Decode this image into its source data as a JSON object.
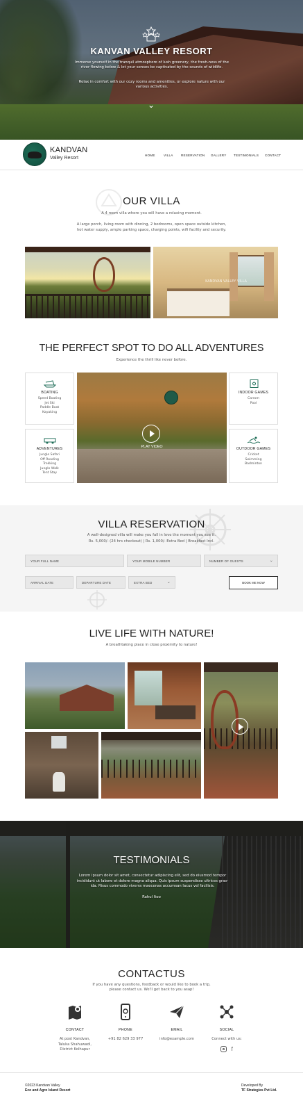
{
  "hero": {
    "title": "KANVAN VALLEY RESORT",
    "para1": "Immerse yourself in the tranquil atmosphere of lush greenery, the fresh-ness of the river flowing below & let your senses be captivated by the sounds of wildlife.",
    "para2": "Relax in comfort with our cozy rooms and amenities, or explore nature with our various activities."
  },
  "nav": {
    "brand": "KANDVAN",
    "brand_sub": "Valley Resort",
    "items": [
      "HOME",
      "VILLA",
      "RESERVATION",
      "GALLERY",
      "TESTIMONIALS",
      "CONTACT"
    ]
  },
  "villa": {
    "title": "OUR VILLA",
    "subtitle": "A 4 room villa where you will have a relaxing moment.",
    "desc": "A large porch, living room with dinning, 2 bedrooms, open space outside kitchen, hot water supply, ample parking space, charging points, wifi facility and security.",
    "watermark": "KANDVAN VALLEY VILLA"
  },
  "adventures": {
    "title": "THE PERFECT SPOT TO DO ALL ADVENTURES",
    "subtitle": "Experience the thrill like never before.",
    "play_label": "PLAY VIDEO",
    "cards": [
      {
        "title": "BOATING",
        "items": [
          "Speed Boating",
          "Jet Ski",
          "Paddle Boat",
          "Kayaking"
        ]
      },
      {
        "title": "ADVENTURES",
        "items": [
          "Jungle Safari",
          "Off Roading",
          "Trekking",
          "Jungle Walk",
          "Tent Stay"
        ]
      },
      {
        "title": "INDOOR GAMES",
        "items": [
          "Carrom",
          "Pool"
        ]
      },
      {
        "title": "OUTDOOR GAMES",
        "items": [
          "Cricket",
          "Swimming",
          "Badminton"
        ]
      }
    ]
  },
  "reservation": {
    "title": "VILLA RESERVATION",
    "subtitle": "A well-designed villa will make you fall in love the moment you see it.",
    "pricing": "Rs. 5,000/- (24 hrs checkout)  |  Rs. 1,000/- Extra Bed  |  Breakfast Incl.",
    "fields": {
      "name": "YOUR FULL NAME",
      "mobile": "YOUR MOBILE NUMBER",
      "guests": "NUMBER OF GUESTS",
      "arrival": "ARRIVAL DATE",
      "departure": "DEPARTURE DATE",
      "extra_bed": "EXTRA BED"
    },
    "button": "BOOK ME NOW"
  },
  "nature": {
    "title": "LIVE LIFE WITH NATURE!",
    "subtitle": "A breathtaking place in close proximity to nature!"
  },
  "testimonials": {
    "title": "TESTIMONIALS",
    "quote": "Lorem ipsum dolor sit amet, consectetur adipiscing elit, sed do eiusmod tempor incididunt ut labore et dolore magna aliqua. Quis ipsum suspendisse ultrices grav-ida. Risus commodo viverra maecenas accumsan lacus vel facilisis.",
    "author": "Rahul Itoo"
  },
  "contact": {
    "title": "CONTACTUS",
    "subtitle1": "If you have any questions, feedback or would like to book a trip,",
    "subtitle2": "please contact us. We'll get back to you asap!",
    "columns": [
      {
        "label": "CONTACT",
        "lines": [
          "At post Kandvan,",
          "Taluka Shahuwadi,",
          "District Kolhapur"
        ],
        "icon": "map-book-icon"
      },
      {
        "label": "PHONE",
        "lines": [
          "+91 82 629 33 977"
        ],
        "icon": "phone-icon"
      },
      {
        "label": "EMAIL",
        "lines": [
          "info@example.com"
        ],
        "icon": "paper-plane-icon"
      },
      {
        "label": "SOCIAL",
        "lines": [
          "Connect with us:"
        ],
        "icon": "network-icon"
      }
    ]
  },
  "footer": {
    "left1": "©2023 Kandvan Valley",
    "left2": "Eco and Agro Island Resort",
    "right1": "Developed By",
    "right2": "TF Strategies Pvt Ltd."
  },
  "colors": {
    "accent": "#1f6e58",
    "dark": "#222222",
    "light_bg": "#f5f5f5"
  }
}
